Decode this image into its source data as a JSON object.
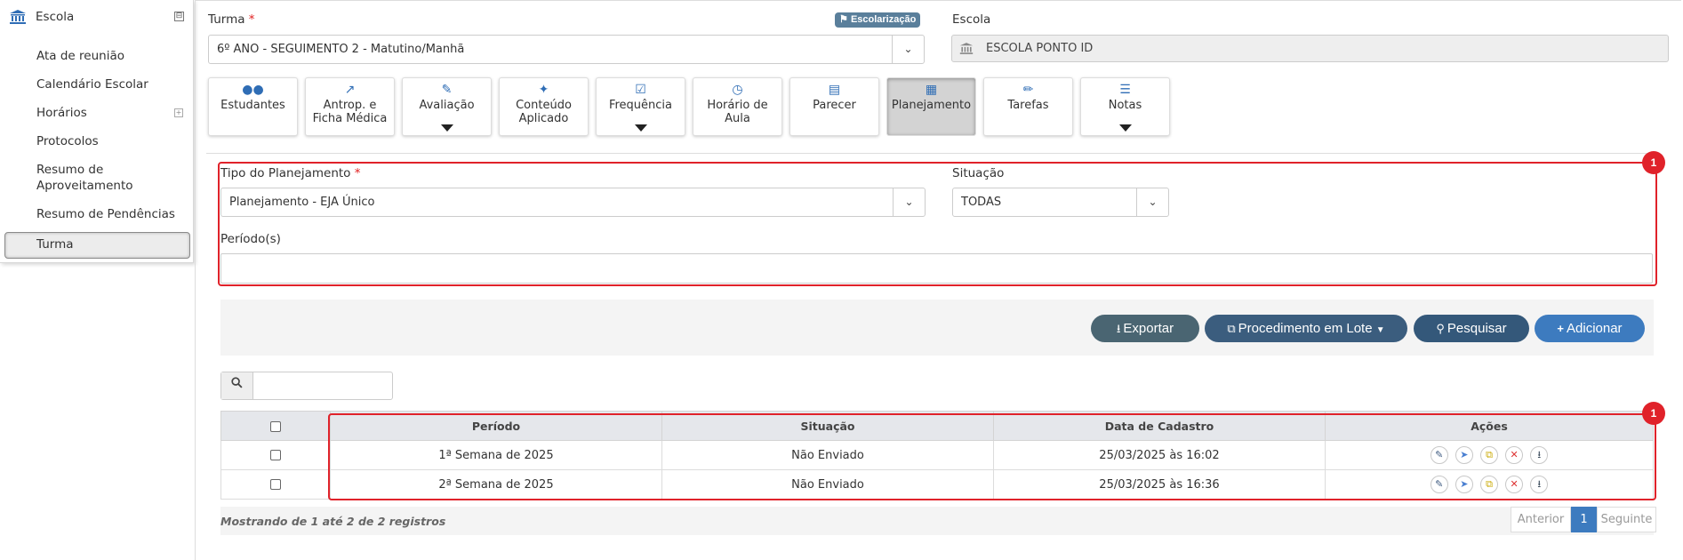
{
  "sidebar": {
    "header": {
      "label": "Escola",
      "toggle": "⊟"
    },
    "items": [
      {
        "label": "Ata de reunião"
      },
      {
        "label": "Calendário Escolar"
      },
      {
        "label": "Horários",
        "expand": "+"
      },
      {
        "label": "Protocolos"
      },
      {
        "label": "Resumo de Aproveitamento"
      },
      {
        "label": "Resumo de Pendências"
      },
      {
        "label": "Turma"
      }
    ]
  },
  "form": {
    "turma_label": "Turma",
    "required_mark": "*",
    "escolarizacao_badge": "Escolarização",
    "turma_value": "6º ANO - SEGUIMENTO 2 - Matutino/Manhã",
    "escola_label": "Escola",
    "escola_value": "ESCOLA PONTO ID"
  },
  "tabs": [
    {
      "label": "Estudantes",
      "icon": "users-icon"
    },
    {
      "label": "Antrop. e Ficha Médica",
      "icon": "line-chart-icon"
    },
    {
      "label": "Avaliação",
      "icon": "edit-icon",
      "dropdown": true
    },
    {
      "label": "Conteúdo Aplicado",
      "icon": "magic-wand-icon"
    },
    {
      "label": "Frequência",
      "icon": "check-square-icon",
      "dropdown": true
    },
    {
      "label": "Horário de Aula",
      "icon": "clock-icon"
    },
    {
      "label": "Parecer",
      "icon": "file-icon"
    },
    {
      "label": "Planejamento",
      "icon": "book-icon",
      "active": true
    },
    {
      "label": "Tarefas",
      "icon": "pencil-icon"
    },
    {
      "label": "Notas",
      "icon": "list-icon",
      "dropdown": true
    }
  ],
  "filters": {
    "tipo_label": "Tipo do Planejamento",
    "tipo_value": "Planejamento - EJA Único",
    "situacao_label": "Situação",
    "situacao_value": "TODAS",
    "periodos_label": "Período(s)"
  },
  "annotations": {
    "marker1": "1",
    "marker2": "1"
  },
  "toolbar": {
    "exportar": "Exportar",
    "procedimento": "Procedimento em Lote",
    "pesquisar": "Pesquisar",
    "adicionar": "Adicionar"
  },
  "search": {
    "placeholder": ""
  },
  "table": {
    "columns": [
      "Período",
      "Situação",
      "Data de Cadastro",
      "Ações"
    ],
    "rows": [
      {
        "periodo": "1ª Semana de 2025",
        "situacao": "Não Enviado",
        "data": "25/03/2025 às 16:02"
      },
      {
        "periodo": "2ª Semana de 2025",
        "situacao": "Não Enviado",
        "data": "25/03/2025 às 16:36"
      }
    ]
  },
  "footer": {
    "info": "Mostrando de 1 até 2 de 2 registros",
    "prev": "Anterior",
    "page": "1",
    "next": "Seguinte"
  },
  "colors": {
    "accent": "#2f6db5",
    "annotation_red": "#e0222a",
    "btn_exportar": "#4a6572",
    "btn_procedimento": "#3b5d7e",
    "btn_pesquisar": "#34587a",
    "btn_adicionar": "#3d7bbf"
  }
}
